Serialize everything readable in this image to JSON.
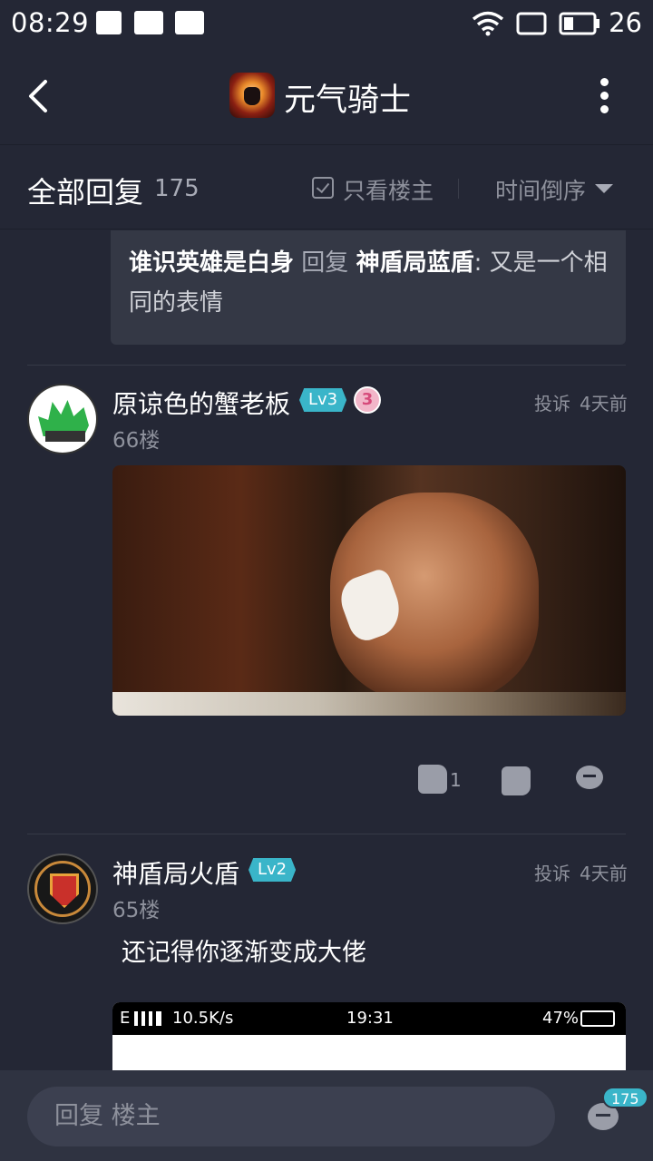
{
  "status_bar": {
    "time": "08:29",
    "battery": "26"
  },
  "header": {
    "title": "元气骑士",
    "app_icon": "app-icon",
    "back_icon": "chevron-left-icon",
    "more_icon": "more-vertical-icon"
  },
  "filter_bar": {
    "title": "全部回复",
    "count": "175",
    "only_op_label": "只看楼主",
    "sort_label": "时间倒序"
  },
  "quote": {
    "author": "谁识英雄是白身",
    "verb": "回复",
    "target": "神盾局蓝盾",
    "text": ": 又是一个相同的表情"
  },
  "posts": [
    {
      "username": "原谅色的蟹老板",
      "level": "Lv3",
      "badge": "3",
      "floor": "66楼",
      "report": "投诉",
      "time_ago": "4天前",
      "likes": "1"
    },
    {
      "username": "神盾局火盾",
      "level": "Lv2",
      "floor": "65楼",
      "report": "投诉",
      "time_ago": "4天前",
      "text": "还记得你逐渐变成大佬",
      "screenshot_bar": {
        "signal": "E",
        "speed": "10.5K/s",
        "time": "19:31",
        "battery": "47%"
      }
    }
  ],
  "bottom_bar": {
    "reply_placeholder": "回复  楼主",
    "comment_count": "175"
  }
}
